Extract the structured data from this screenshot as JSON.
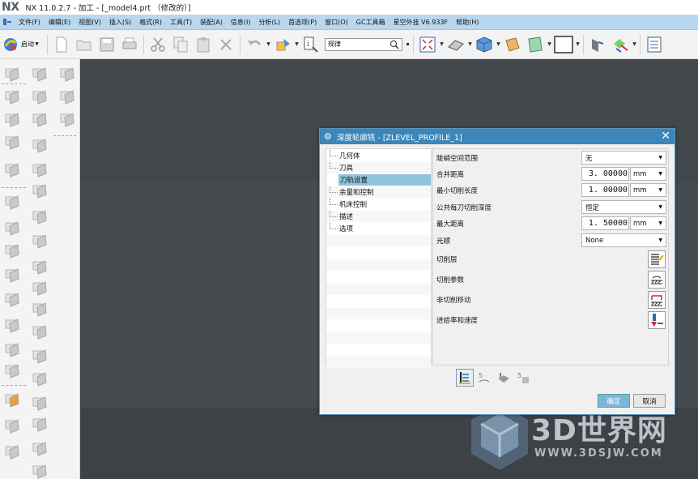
{
  "app": {
    "logo": "NX",
    "title": "NX 11.0.2.7 - 加工 - [_model4.prt （修改的）]"
  },
  "menubar": {
    "items": [
      "文件(F)",
      "编辑(E)",
      "视图(V)",
      "插入(S)",
      "格式(R)",
      "工具(T)",
      "装配(A)",
      "信息(I)",
      "分析(L)",
      "首选项(P)",
      "窗口(O)",
      "GC工具箱",
      "星空外挂 V6.933F",
      "帮助(H)"
    ]
  },
  "toolbar": {
    "start_label": "启动",
    "filter_value": "规律",
    "icons": [
      "new-icon",
      "open-icon",
      "save-icon",
      "print-icon",
      "cut-icon",
      "copy-icon",
      "paste-icon",
      "delete-icon",
      "undo-icon",
      "repeat-command-icon",
      "info-icon",
      "fit-view-icon",
      "shaded-view-icon",
      "cube-view-icon",
      "background-icon",
      "layer-icon",
      "color-box-icon",
      "operation-navigator-icon",
      "generate-toolpath-icon",
      "more-icon"
    ]
  },
  "dialog": {
    "title": "深度轮廓铣 - [ZLEVEL_PROFILE_1]",
    "tree_items": [
      "几何体",
      "刀具",
      "刀轨设置",
      "余量和控制",
      "机床控制",
      "描述",
      "选项"
    ],
    "selected_index": 2,
    "props": {
      "steep_label": "陡峭空间范围",
      "steep_value": "无",
      "merge_label": "合并距离",
      "merge_value": "3. 00000",
      "merge_unit": "mm",
      "mincut_label": "最小切削长度",
      "mincut_value": "1. 00000",
      "mincut_unit": "mm",
      "depth_label": "公共每刀切削深度",
      "depth_value": "恒定",
      "maxdist_label": "最大距离",
      "maxdist_value": "1. 50000",
      "maxdist_unit": "mm",
      "smooth_label": "光顺",
      "smooth_value": "None",
      "cutlevels_label": "切削层",
      "cutparams_label": "切削参数",
      "noncut_label": "非切削移动",
      "feeds_label": "进给率和速度"
    },
    "ok_label": "确定",
    "cancel_label": "取消"
  },
  "watermark": {
    "text": "3D世界网",
    "url": "WWW.3DSJW.COM"
  },
  "colors": {
    "menubar_bg": "#b9d8ef",
    "dialog_title_bg": "#3d86bb",
    "tree_selected_bg": "#8fc4db",
    "viewport_bg": "#464b50",
    "ok_bg": "#7eb6d7"
  }
}
